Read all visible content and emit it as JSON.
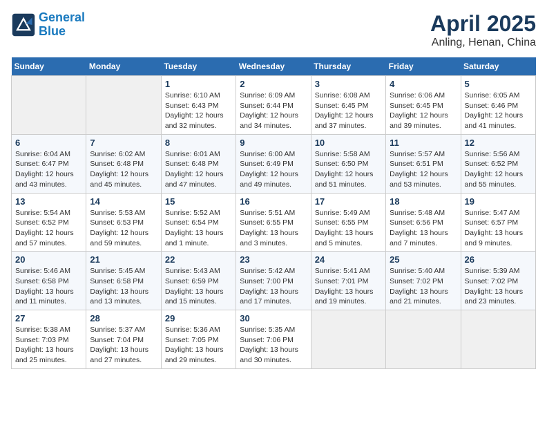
{
  "header": {
    "logo_line1": "General",
    "logo_line2": "Blue",
    "title": "April 2025",
    "subtitle": "Anling, Henan, China"
  },
  "weekdays": [
    "Sunday",
    "Monday",
    "Tuesday",
    "Wednesday",
    "Thursday",
    "Friday",
    "Saturday"
  ],
  "weeks": [
    [
      {
        "day": "",
        "empty": true
      },
      {
        "day": "",
        "empty": true
      },
      {
        "day": "1",
        "sunrise": "6:10 AM",
        "sunset": "6:43 PM",
        "daylight": "12 hours and 32 minutes."
      },
      {
        "day": "2",
        "sunrise": "6:09 AM",
        "sunset": "6:44 PM",
        "daylight": "12 hours and 34 minutes."
      },
      {
        "day": "3",
        "sunrise": "6:08 AM",
        "sunset": "6:45 PM",
        "daylight": "12 hours and 37 minutes."
      },
      {
        "day": "4",
        "sunrise": "6:06 AM",
        "sunset": "6:45 PM",
        "daylight": "12 hours and 39 minutes."
      },
      {
        "day": "5",
        "sunrise": "6:05 AM",
        "sunset": "6:46 PM",
        "daylight": "12 hours and 41 minutes."
      }
    ],
    [
      {
        "day": "6",
        "sunrise": "6:04 AM",
        "sunset": "6:47 PM",
        "daylight": "12 hours and 43 minutes."
      },
      {
        "day": "7",
        "sunrise": "6:02 AM",
        "sunset": "6:48 PM",
        "daylight": "12 hours and 45 minutes."
      },
      {
        "day": "8",
        "sunrise": "6:01 AM",
        "sunset": "6:48 PM",
        "daylight": "12 hours and 47 minutes."
      },
      {
        "day": "9",
        "sunrise": "6:00 AM",
        "sunset": "6:49 PM",
        "daylight": "12 hours and 49 minutes."
      },
      {
        "day": "10",
        "sunrise": "5:58 AM",
        "sunset": "6:50 PM",
        "daylight": "12 hours and 51 minutes."
      },
      {
        "day": "11",
        "sunrise": "5:57 AM",
        "sunset": "6:51 PM",
        "daylight": "12 hours and 53 minutes."
      },
      {
        "day": "12",
        "sunrise": "5:56 AM",
        "sunset": "6:52 PM",
        "daylight": "12 hours and 55 minutes."
      }
    ],
    [
      {
        "day": "13",
        "sunrise": "5:54 AM",
        "sunset": "6:52 PM",
        "daylight": "12 hours and 57 minutes."
      },
      {
        "day": "14",
        "sunrise": "5:53 AM",
        "sunset": "6:53 PM",
        "daylight": "12 hours and 59 minutes."
      },
      {
        "day": "15",
        "sunrise": "5:52 AM",
        "sunset": "6:54 PM",
        "daylight": "13 hours and 1 minute."
      },
      {
        "day": "16",
        "sunrise": "5:51 AM",
        "sunset": "6:55 PM",
        "daylight": "13 hours and 3 minutes."
      },
      {
        "day": "17",
        "sunrise": "5:49 AM",
        "sunset": "6:55 PM",
        "daylight": "13 hours and 5 minutes."
      },
      {
        "day": "18",
        "sunrise": "5:48 AM",
        "sunset": "6:56 PM",
        "daylight": "13 hours and 7 minutes."
      },
      {
        "day": "19",
        "sunrise": "5:47 AM",
        "sunset": "6:57 PM",
        "daylight": "13 hours and 9 minutes."
      }
    ],
    [
      {
        "day": "20",
        "sunrise": "5:46 AM",
        "sunset": "6:58 PM",
        "daylight": "13 hours and 11 minutes."
      },
      {
        "day": "21",
        "sunrise": "5:45 AM",
        "sunset": "6:58 PM",
        "daylight": "13 hours and 13 minutes."
      },
      {
        "day": "22",
        "sunrise": "5:43 AM",
        "sunset": "6:59 PM",
        "daylight": "13 hours and 15 minutes."
      },
      {
        "day": "23",
        "sunrise": "5:42 AM",
        "sunset": "7:00 PM",
        "daylight": "13 hours and 17 minutes."
      },
      {
        "day": "24",
        "sunrise": "5:41 AM",
        "sunset": "7:01 PM",
        "daylight": "13 hours and 19 minutes."
      },
      {
        "day": "25",
        "sunrise": "5:40 AM",
        "sunset": "7:02 PM",
        "daylight": "13 hours and 21 minutes."
      },
      {
        "day": "26",
        "sunrise": "5:39 AM",
        "sunset": "7:02 PM",
        "daylight": "13 hours and 23 minutes."
      }
    ],
    [
      {
        "day": "27",
        "sunrise": "5:38 AM",
        "sunset": "7:03 PM",
        "daylight": "13 hours and 25 minutes."
      },
      {
        "day": "28",
        "sunrise": "5:37 AM",
        "sunset": "7:04 PM",
        "daylight": "13 hours and 27 minutes."
      },
      {
        "day": "29",
        "sunrise": "5:36 AM",
        "sunset": "7:05 PM",
        "daylight": "13 hours and 29 minutes."
      },
      {
        "day": "30",
        "sunrise": "5:35 AM",
        "sunset": "7:06 PM",
        "daylight": "13 hours and 30 minutes."
      },
      {
        "day": "",
        "empty": true
      },
      {
        "day": "",
        "empty": true
      },
      {
        "day": "",
        "empty": true
      }
    ]
  ]
}
